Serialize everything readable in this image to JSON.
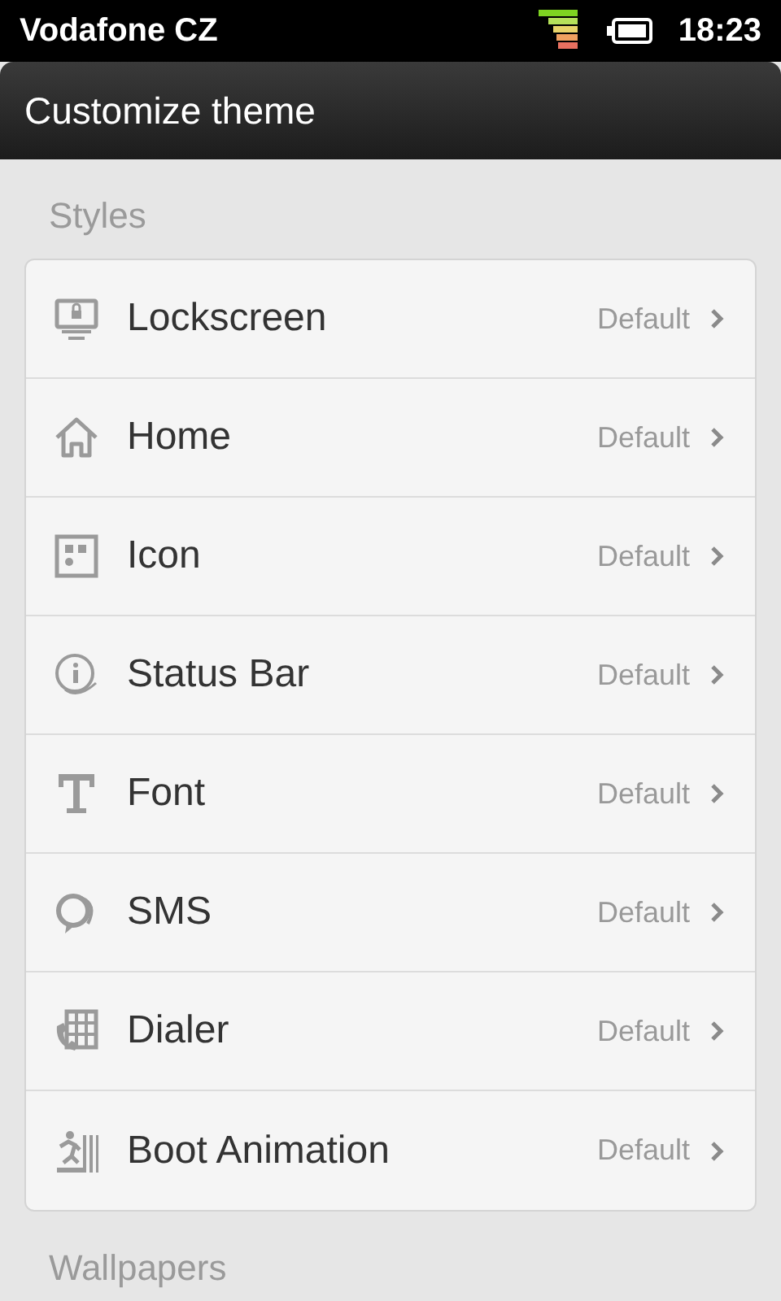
{
  "status_bar": {
    "carrier": "Vodafone CZ",
    "time": "18:23"
  },
  "title_bar": {
    "title": "Customize theme"
  },
  "sections": [
    {
      "header": "Styles",
      "items": [
        {
          "kind": "lockscreen",
          "label": "Lockscreen",
          "value": "Default"
        },
        {
          "kind": "home",
          "label": "Home",
          "value": "Default"
        },
        {
          "kind": "grid",
          "label": "Icon",
          "value": "Default"
        },
        {
          "kind": "info",
          "label": "Status Bar",
          "value": "Default"
        },
        {
          "kind": "font",
          "label": "Font",
          "value": "Default"
        },
        {
          "kind": "chat",
          "label": "SMS",
          "value": "Default"
        },
        {
          "kind": "dialer",
          "label": "Dialer",
          "value": "Default"
        },
        {
          "kind": "boot",
          "label": "Boot Animation",
          "value": "Default"
        }
      ]
    },
    {
      "header": "Wallpapers"
    }
  ]
}
